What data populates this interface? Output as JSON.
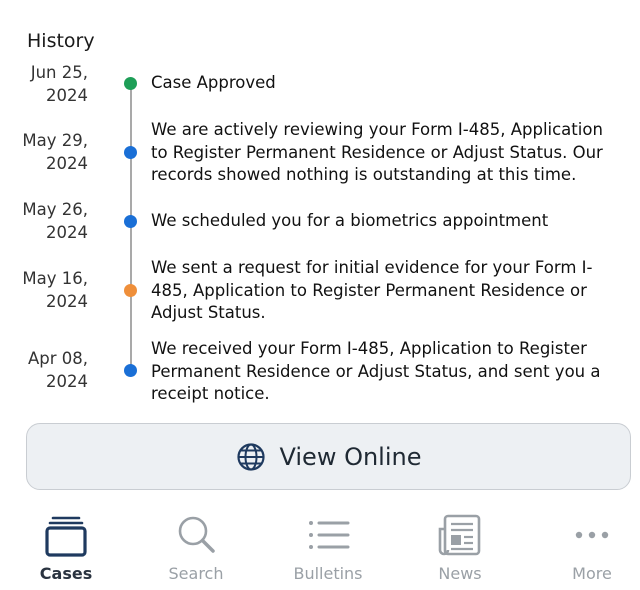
{
  "history": {
    "title": "History",
    "events": [
      {
        "date": "Jun 25,\n2024",
        "text": "Case Approved",
        "status_color": "#1e9e57"
      },
      {
        "date": "May 29,\n2024",
        "text": "We are actively reviewing your Form I-485, Application to Register Permanent Residence or Adjust Status. Our records showed nothing is outstanding at this time.",
        "status_color": "#1a6fd6"
      },
      {
        "date": "May 26,\n2024",
        "text": "We scheduled you for a biometrics appointment",
        "status_color": "#1a6fd6"
      },
      {
        "date": "May 16,\n2024",
        "text": "We sent a request for initial evidence for your Form I-485, Application to Register Permanent Residence or Adjust Status.",
        "status_color": "#ef8f3a"
      },
      {
        "date": "Apr 08,\n2024",
        "text": "We received your Form I-485, Application to Register Permanent Residence or Adjust Status, and sent you a receipt notice.",
        "status_color": "#1a6fd6"
      }
    ]
  },
  "view_online": {
    "label": "View Online",
    "icon": "globe-icon"
  },
  "tabbar": {
    "tabs": [
      {
        "label": "Cases",
        "icon": "cases-icon",
        "active": true
      },
      {
        "label": "Search",
        "icon": "search-icon",
        "active": false
      },
      {
        "label": "Bulletins",
        "icon": "bulletins-list-icon",
        "active": false
      },
      {
        "label": "News",
        "icon": "newspaper-icon",
        "active": false
      },
      {
        "label": "More",
        "icon": "more-dots-icon",
        "active": false
      }
    ]
  }
}
